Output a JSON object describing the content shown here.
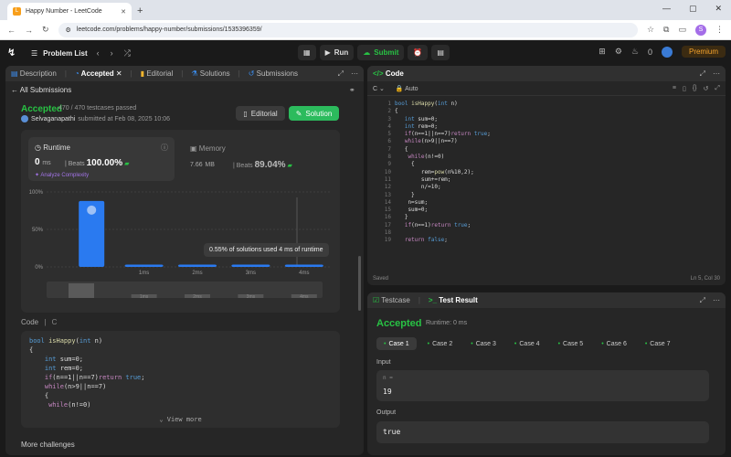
{
  "browser": {
    "tab_title": "Happy Number - LeetCode",
    "url": "leetcode.com/problems/happy-number/submissions/1535396359/",
    "profile_initial": "S"
  },
  "topbar": {
    "problem_list": "Problem List",
    "run": "Run",
    "submit": "Submit",
    "streak": "0",
    "premium": "Premium"
  },
  "left_tabs": {
    "description": "Description",
    "accepted": "Accepted",
    "editorial": "Editorial",
    "solutions": "Solutions",
    "submissions": "Submissions"
  },
  "submission": {
    "back": "All Submissions",
    "status": "Accepted",
    "testcases": "470 / 470 testcases passed",
    "user": "Selvaganapathi",
    "submitted_on": "submitted at Feb 08, 2025 10:06",
    "editorial_btn": "Editorial",
    "solution_btn": "Solution"
  },
  "stats": {
    "runtime_label": "Runtime",
    "runtime_value": "0",
    "runtime_unit": "ms",
    "beats_label": "Beats",
    "runtime_beats": "100.00%",
    "analyze": "Analyze Complexity",
    "memory_label": "Memory",
    "memory_value": "7.66",
    "memory_unit": "MB",
    "memory_beats": "89.04%",
    "tooltip": "0.55% of solutions used 4 ms of runtime"
  },
  "chart_data": {
    "type": "bar",
    "categories": [
      "0ms",
      "1ms",
      "2ms",
      "3ms",
      "4ms"
    ],
    "values": [
      88,
      3,
      3,
      3,
      3
    ],
    "ytick_labels": [
      "100%",
      "50%",
      "0%"
    ],
    "ylim": [
      0,
      100
    ],
    "xtick_labels": [
      "1ms",
      "2ms",
      "3ms",
      "4ms"
    ],
    "highlight_index": 0
  },
  "code_section": {
    "label": "Code",
    "lang": "C",
    "lines": [
      "bool isHappy(int n)",
      "{",
      "    int sum=0;",
      "    int rem=0;",
      "    if(n==1||n==7)return true;",
      "    while(n>9||n==7)",
      "    {",
      "     while(n!=0)"
    ],
    "view_more": "View more"
  },
  "more_challenges": "More challenges",
  "editor": {
    "title": "Code",
    "lang": "C",
    "mode": "Auto",
    "saved": "Saved",
    "position": "Ln 5, Col 30",
    "lines": [
      "bool isHappy(int n)",
      "{",
      "   int sum=0;",
      "   int rem=0;",
      "   if(n==1||n==7)return true;",
      "   while(n>9||n==7)",
      "   {",
      "    while(n!=0)",
      "     {",
      "        rem=pow(n%10,2);",
      "        sum+=rem;",
      "        n/=10;",
      "     }",
      "    n=sum;",
      "    sum=0;",
      "   }",
      "   if(n==1)return true;",
      "",
      "   return false;"
    ]
  },
  "test": {
    "testcase_tab": "Testcase",
    "result_tab": "Test Result",
    "status": "Accepted",
    "runtime": "Runtime: 0 ms",
    "cases": [
      "Case 1",
      "Case 2",
      "Case 3",
      "Case 4",
      "Case 5",
      "Case 6",
      "Case 7"
    ],
    "input_label": "Input",
    "input_var": "n =",
    "input_value": "19",
    "output_label": "Output",
    "output_value": "true"
  }
}
